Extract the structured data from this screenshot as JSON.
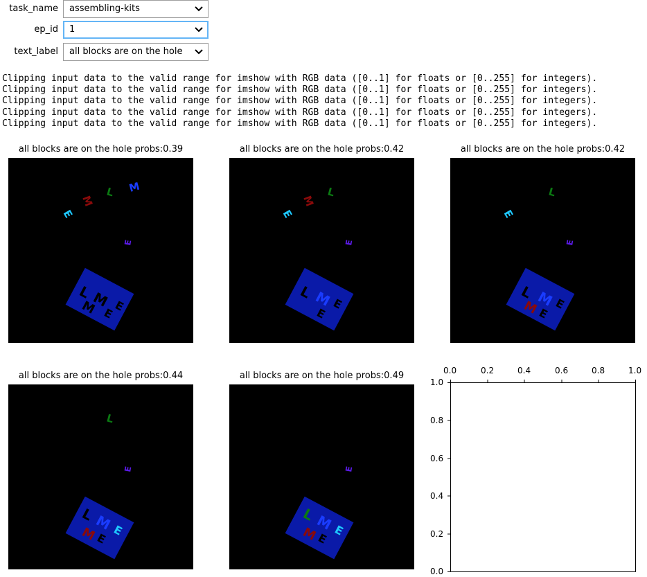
{
  "widgets": [
    {
      "label": "task_name",
      "value": "assembling-kits"
    },
    {
      "label": "ep_id",
      "value": "1"
    },
    {
      "label": "text_label",
      "value": "all blocks are on the hole"
    }
  ],
  "console": {
    "lines": [
      "Clipping input data to the valid range for imshow with RGB data ([0..1] for floats or [0..255] for integers).",
      "Clipping input data to the valid range for imshow with RGB data ([0..1] for floats or [0..255] for integers).",
      "Clipping input data to the valid range for imshow with RGB data ([0..1] for floats or [0..255] for integers).",
      "Clipping input data to the valid range for imshow with RGB data ([0..1] for floats or [0..255] for integers).",
      "Clipping input data to the valid range for imshow with RGB data ([0..1] for floats or [0..255] for integers)."
    ]
  },
  "panels": [
    {
      "title": "all blocks are on the hole probs:0.39"
    },
    {
      "title": "all blocks are on the hole probs:0.42"
    },
    {
      "title": "all blocks are on the hole probs:0.42"
    },
    {
      "title": "all blocks are on the hole probs:0.44"
    },
    {
      "title": "all blocks are on the hole probs:0.49"
    }
  ],
  "empty_axes": {
    "x_ticks": [
      "0.0",
      "0.2",
      "0.4",
      "0.6",
      "0.8",
      "1.0"
    ],
    "y_ticks": [
      "1.0",
      "0.8",
      "0.6",
      "0.4",
      "0.2",
      "0.0"
    ]
  },
  "colors": {
    "select_border": "#9e9e9e",
    "select_focus": "#64b5f6",
    "image_bg": "#000000",
    "tray": "#0a1aa8",
    "cyan": "#1ec8ff",
    "red": "#8a0a0a",
    "green": "#0b7a12",
    "blue": "#1a3cff",
    "purple": "#5a1ae6"
  }
}
